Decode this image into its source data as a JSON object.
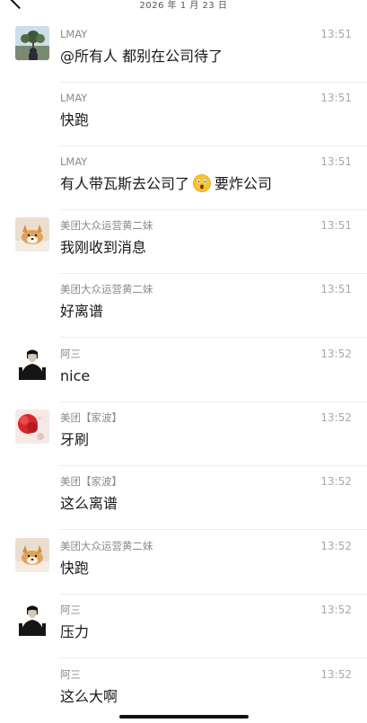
{
  "header": {
    "date": "2026 年 1 月 23 日"
  },
  "messages": [
    {
      "sender": "LMAY",
      "time": "13:51",
      "text": "@所有人 都别在公司待了",
      "avatar": "photo-avatar"
    },
    {
      "sender": "LMAY",
      "time": "13:51",
      "text": "快跑",
      "avatar": ""
    },
    {
      "sender": "LMAY",
      "time": "13:51",
      "text_before": "有人带瓦斯去公司了",
      "emoji": "shocked-face-emoji",
      "text_after": "要炸公司",
      "avatar": ""
    },
    {
      "sender": "美团大众运营黄二妹",
      "time": "13:51",
      "text": "我刚收到消息",
      "avatar": "dog-avatar"
    },
    {
      "sender": "美团大众运营黄二妹",
      "time": "13:51",
      "text": "好离谱",
      "avatar": ""
    },
    {
      "sender": "阿三",
      "time": "13:52",
      "text": "nice",
      "avatar": "man-avatar"
    },
    {
      "sender": "美团【家波】",
      "time": "13:52",
      "text": "牙刷",
      "avatar": "red-avatar"
    },
    {
      "sender": "美团【家波】",
      "time": "13:52",
      "text": "这么离谱",
      "avatar": ""
    },
    {
      "sender": "美团大众运营黄二妹",
      "time": "13:52",
      "text": "快跑",
      "avatar": "dog-avatar"
    },
    {
      "sender": "阿三",
      "time": "13:52",
      "text": "压力",
      "avatar": "man-avatar"
    },
    {
      "sender": "阿三",
      "time": "13:52",
      "text": "这么大啊",
      "avatar": ""
    }
  ]
}
